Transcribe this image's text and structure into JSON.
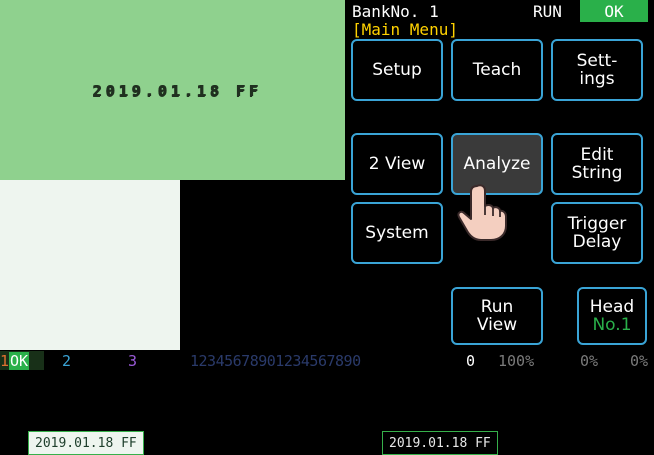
{
  "image": {
    "dot_text": "2019.01.18 FF",
    "date_left": "2019.01.18 FF",
    "date_right": "2019.01.18 FF"
  },
  "panel": {
    "bank": "BankNo. 1",
    "menu_title": "[Main Menu]",
    "run": "RUN",
    "ok": "OK",
    "buttons": {
      "setup": "Setup",
      "teach": "Teach",
      "settings_1": "Sett-",
      "settings_2": "ings",
      "two_view": "2 View",
      "analyze": "Analyze",
      "edit_1": "Edit",
      "edit_2": "String",
      "system": "System",
      "trigger_1": "Trigger",
      "trigger_2": "Delay",
      "runview_1": "Run",
      "runview_2": "View",
      "head_1": "Head",
      "head_2": "No.1"
    }
  },
  "status": {
    "s1_num": "1",
    "s1_ok": "OK",
    "s2_num": "2",
    "s3_num": "3",
    "sequence": "12345678901234567890",
    "zero": "0",
    "pct1": "100%",
    "pct2": "0%",
    "pct3": "0%"
  },
  "colors": {
    "accent_green": "#2ab04a",
    "button_border": "#3aa4d6",
    "menu_yellow": "#ffd200"
  }
}
